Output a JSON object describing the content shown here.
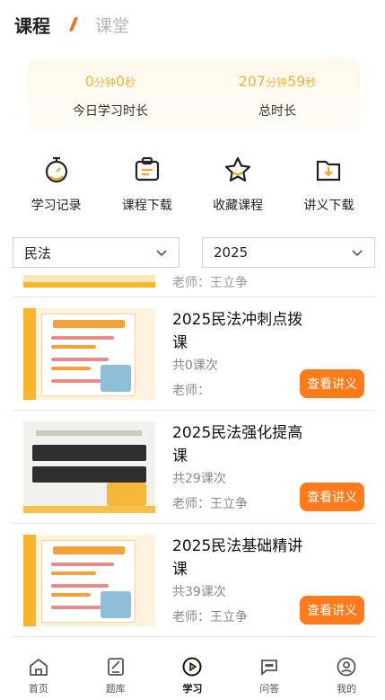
{
  "header": {
    "tab_active": "课程",
    "tab_inactive": "课堂"
  },
  "stats": {
    "today": {
      "minutes": "0",
      "min_unit": "分钟",
      "seconds": "0",
      "sec_unit": "秒",
      "label": "今日学习时长"
    },
    "total": {
      "minutes": "207",
      "min_unit": "分钟",
      "seconds": "59",
      "sec_unit": "秒",
      "label": "总时长"
    },
    "accent_color": "#f2b43a"
  },
  "actions": [
    {
      "label": "学习记录",
      "icon": "stopwatch-icon"
    },
    {
      "label": "课程下载",
      "icon": "clipboard-icon"
    },
    {
      "label": "收藏课程",
      "icon": "star-icon"
    },
    {
      "label": "讲义下载",
      "icon": "download-folder-icon"
    }
  ],
  "filters": {
    "subject": "民法",
    "year": "2025"
  },
  "partial_row": {
    "text": "老师：王立争"
  },
  "courses": [
    {
      "title": "2025民法冲刺点拨课",
      "count": "共0课次",
      "teacher": "老师：",
      "button": "查看讲义"
    },
    {
      "title": "2025民法强化提高课",
      "count": "共29课次",
      "teacher": "老师：王立争",
      "button": "查看讲义"
    },
    {
      "title": "2025民法基础精讲课",
      "count": "共39课次",
      "teacher": "老师：王立争",
      "button": "查看讲义"
    }
  ],
  "button_color": "#ff7a1a",
  "nav": [
    {
      "label": "首页",
      "icon": "home-icon"
    },
    {
      "label": "题库",
      "icon": "question-bank-icon"
    },
    {
      "label": "学习",
      "icon": "play-icon",
      "active": true
    },
    {
      "label": "问答",
      "icon": "chat-icon"
    },
    {
      "label": "我的",
      "icon": "profile-icon"
    }
  ]
}
